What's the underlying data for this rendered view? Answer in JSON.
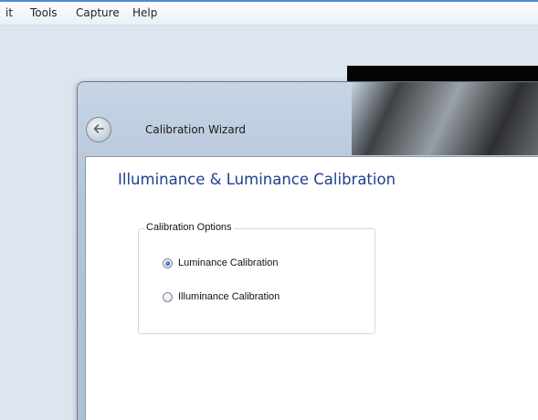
{
  "menubar": {
    "items": [
      {
        "label": "it"
      },
      {
        "label": "Tools"
      },
      {
        "label": "Capture"
      },
      {
        "label": "Help"
      }
    ]
  },
  "wizard": {
    "title": "Calibration Wizard",
    "heading": "Illuminance & Luminance Calibration",
    "group": {
      "legend": "Calibration Options",
      "options": [
        {
          "label": "Luminance Calibration",
          "checked": true
        },
        {
          "label": "Illuminance Calibration",
          "checked": false
        }
      ]
    }
  },
  "colors": {
    "heading": "#1e3f8c",
    "radio_selected": "#1e56b8"
  },
  "icons": {
    "back": "back-arrow-icon"
  }
}
